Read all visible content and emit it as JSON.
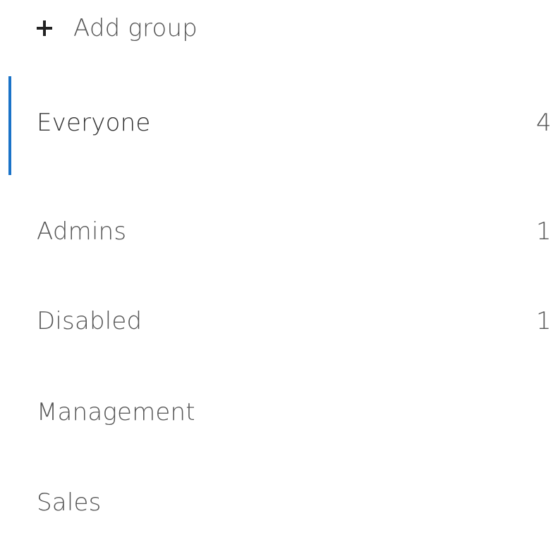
{
  "add_group": {
    "label": "Add group",
    "icon": "plus-icon"
  },
  "accent_color": "#1a73c8",
  "groups": [
    {
      "name": "Everyone",
      "count": "4",
      "active": true
    },
    {
      "name": "Admins",
      "count": "1",
      "active": false
    },
    {
      "name": "Disabled",
      "count": "1",
      "active": false
    },
    {
      "name": "Management",
      "count": "",
      "active": false
    },
    {
      "name": "Sales",
      "count": "",
      "active": false
    }
  ]
}
